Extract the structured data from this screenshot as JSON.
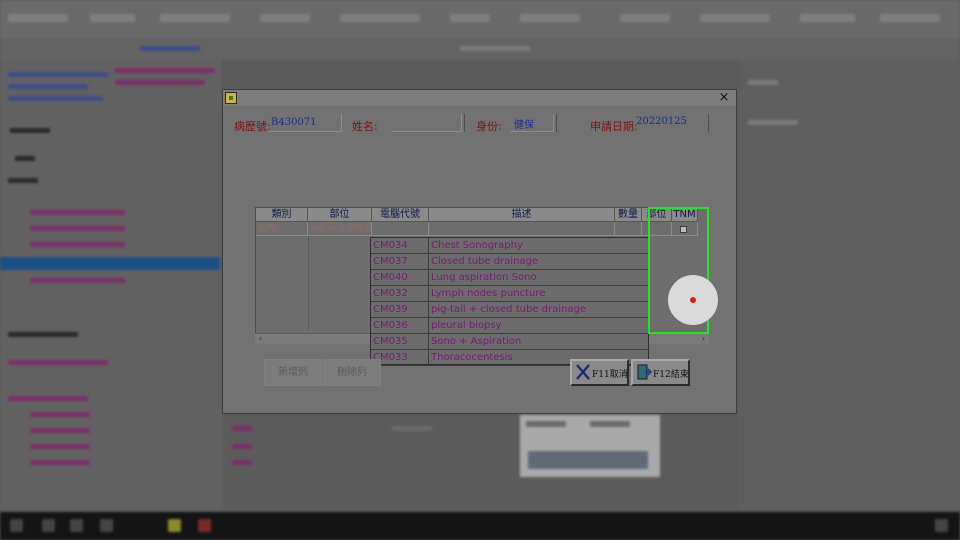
{
  "dialog": {
    "close_glyph": "×",
    "fields": {
      "record_label": "病歷號:",
      "record_value": "B430071",
      "name_label": "姓名:",
      "identity_label": "身份:",
      "identity_value": "健保",
      "date_label": "申請日期:",
      "date_value": "20220125"
    },
    "grid": {
      "columns": [
        "類別",
        "部位",
        "電腦代號",
        "描述",
        "數量",
        "部位",
        "TNM"
      ],
      "row": {
        "category": "胸內",
        "site": "胸腔超音波檢查"
      },
      "scroll_left": "‹",
      "scroll_right": "›"
    },
    "dropdown": [
      {
        "code": "CM034",
        "desc": "Chest Sonography"
      },
      {
        "code": "CM037",
        "desc": "Closed tube drainage"
      },
      {
        "code": "CM040",
        "desc": "Lung aspiration Sono"
      },
      {
        "code": "CM032",
        "desc": "Lymph nodes puncture"
      },
      {
        "code": "CM039",
        "desc": "pig-tail + closed tube drainage"
      },
      {
        "code": "CM036",
        "desc": "pleural biopsy"
      },
      {
        "code": "CM035",
        "desc": "Sono + Aspiration"
      },
      {
        "code": "CM033",
        "desc": "Thoracocentesis"
      }
    ],
    "buttons": {
      "add_row": "新增列",
      "delete_row": "刪除列",
      "cancel": "F11取消",
      "finish": "F12結束"
    }
  },
  "colors": {
    "highlight": "#1ee81e",
    "cursor_dot": "#e61919",
    "label": "#7d1212",
    "value": "#1c2c8c",
    "dropdown_text": "#7a1876"
  }
}
